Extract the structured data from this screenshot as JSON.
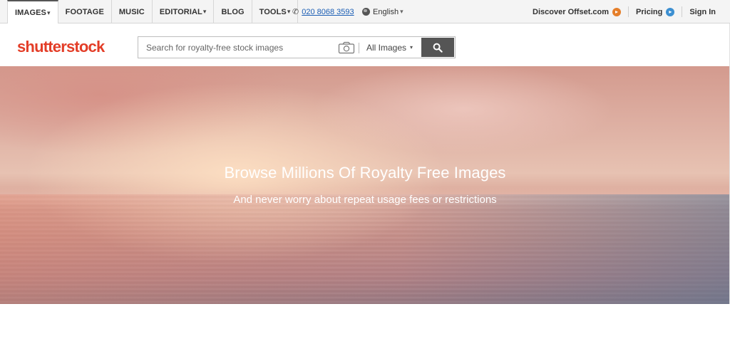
{
  "nav": {
    "tabs": [
      {
        "label": "IMAGES",
        "caret": "▾",
        "active": true
      },
      {
        "label": "FOOTAGE",
        "caret": ""
      },
      {
        "label": "MUSIC",
        "caret": ""
      },
      {
        "label": "EDITORIAL",
        "caret": "▾"
      },
      {
        "label": "BLOG",
        "caret": ""
      },
      {
        "label": "TOOLS",
        "caret": "▾"
      }
    ],
    "phone": "020 8068 3593",
    "language": "English",
    "language_caret": "▾",
    "right": [
      {
        "label": "Discover Offset.com",
        "icon": "orange-arrow-circle-icon",
        "color": "#e57f2a"
      },
      {
        "label": "Pricing",
        "icon": "blue-arrow-circle-icon",
        "color": "#3c8fd1"
      },
      {
        "label": "Sign In",
        "icon": ""
      }
    ]
  },
  "header": {
    "logo": "shutterstock",
    "logo_color": "#e33d27",
    "search_placeholder": "Search for royalty-free stock images",
    "search_type": "All Images",
    "search_button_color": "#555555"
  },
  "hero": {
    "title": "Browse Millions Of Royalty Free Images",
    "subtitle": "And never worry about repeat usage fees or restrictions"
  }
}
